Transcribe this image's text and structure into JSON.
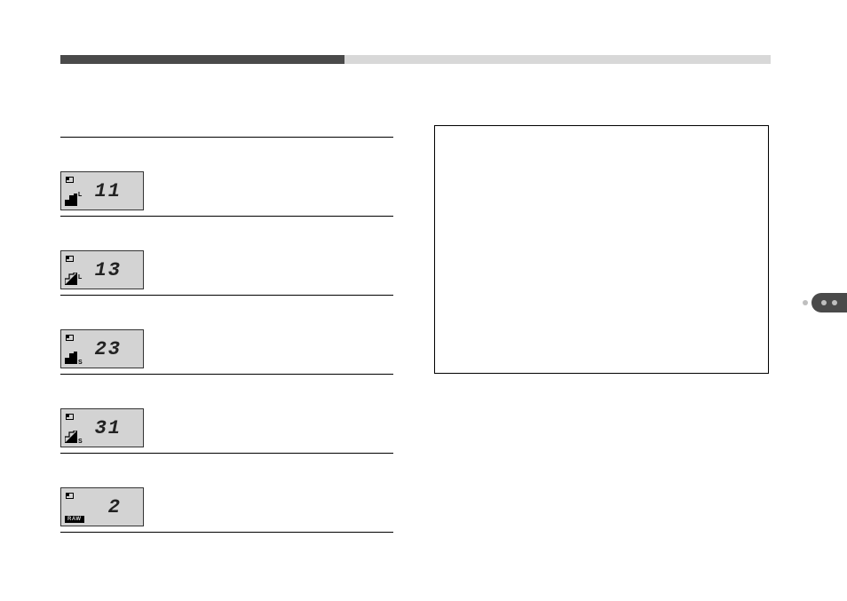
{
  "progress": {
    "dark_percent": 40,
    "light_percent": 60
  },
  "rows": [
    {
      "size_label": "L",
      "size_pos": "top",
      "stair": "fine",
      "number": "11",
      "raw": false
    },
    {
      "size_label": "L",
      "size_pos": "middle",
      "stair": "normal",
      "number": "13",
      "raw": false
    },
    {
      "size_label": "S",
      "size_pos": "bottom",
      "stair": "fine",
      "number": "23",
      "raw": false
    },
    {
      "size_label": "S",
      "size_pos": "bottom",
      "stair": "normal",
      "number": "31",
      "raw": false
    },
    {
      "size_label": "",
      "size_pos": "",
      "stair": "",
      "number": "2",
      "raw": true,
      "raw_label": "RAW"
    }
  ]
}
